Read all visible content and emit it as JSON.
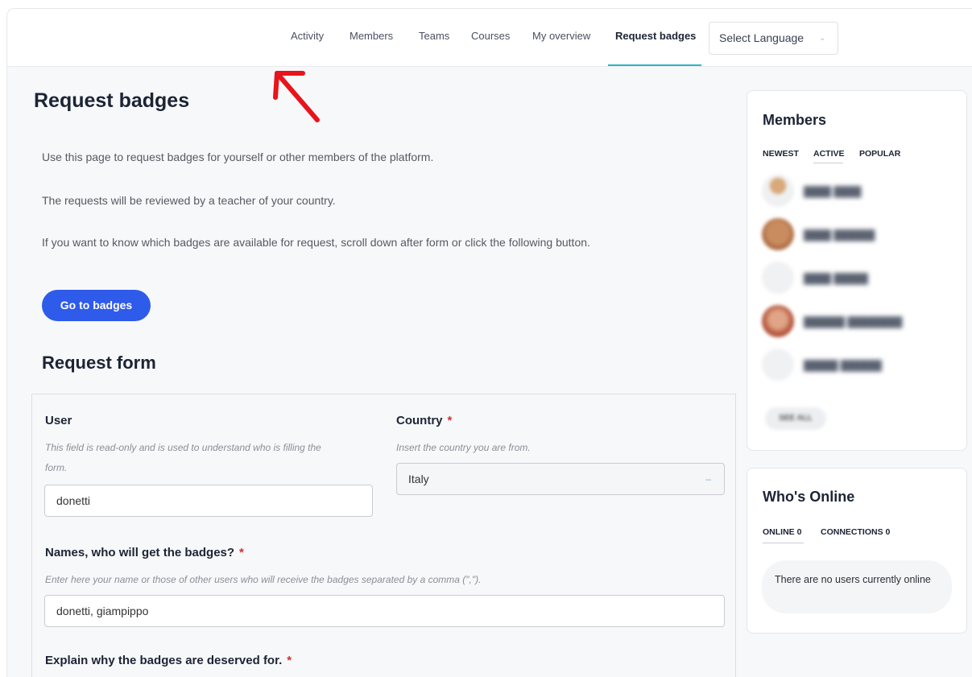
{
  "nav": {
    "items": [
      "Activity",
      "Members",
      "Teams",
      "Courses",
      "My overview",
      "Request badges"
    ],
    "active": "Request badges",
    "language_select": "Select Language"
  },
  "page": {
    "title": "Request badges",
    "intro": [
      "Use this page to request badges for yourself or other members of the platform.",
      "The requests will be reviewed by a teacher of your country.",
      "If you want to know which badges are available for request, scroll down after form or click the following button."
    ],
    "go_button": "Go to badges",
    "form_title": "Request form"
  },
  "form": {
    "user": {
      "label": "User",
      "help_line1": "This field is read-only and is used to understand who is filling the",
      "help_line2": "form.",
      "value": "donetti"
    },
    "country": {
      "label": "Country",
      "required": "*",
      "help": "Insert the country you are from.",
      "value": "Italy"
    },
    "names": {
      "label": "Names, who will get the badges?",
      "required": "*",
      "help": "Enter here your name or those of other users who will receive the badges separated by a comma (\",\").",
      "value": "donetti, giampippo"
    },
    "explain": {
      "label": "Explain why the badges are deserved for.",
      "required": "*"
    }
  },
  "members_widget": {
    "title": "Members",
    "tabs": [
      "NEWEST",
      "ACTIVE",
      "POPULAR"
    ],
    "active_tab": "ACTIVE",
    "see_all": "SEE ALL"
  },
  "whos_online": {
    "title": "Who's Online",
    "tabs": [
      "ONLINE 0",
      "CONNECTIONS 0"
    ],
    "active_tab": "ONLINE 0",
    "message": "There are no users currently online"
  },
  "colors": {
    "accent": "#2f5bea",
    "nav_underline": "#2bb5c4",
    "required": "#d32f2f",
    "annotation_arrow": "#e8141b"
  }
}
